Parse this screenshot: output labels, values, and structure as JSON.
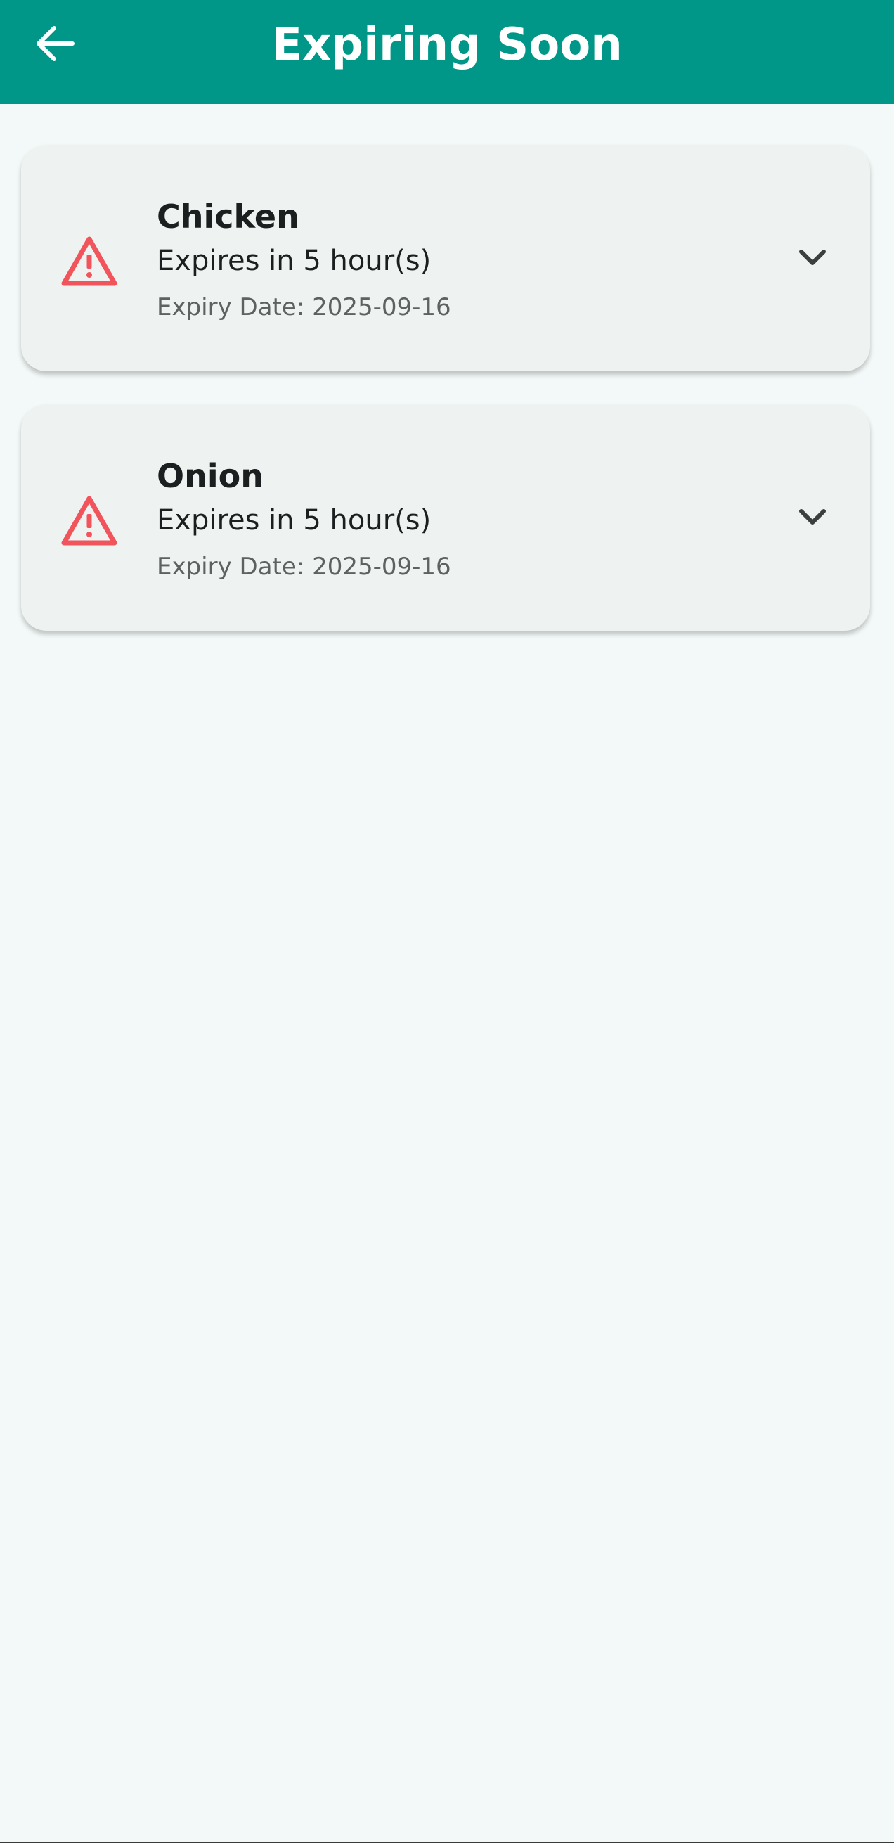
{
  "appbar": {
    "title": "Expiring Soon",
    "back_icon": "arrow-left-icon",
    "color": "#009688"
  },
  "items": [
    {
      "name": "Chicken",
      "expires": "Expires in 5 hour(s)",
      "expiry_date": "Expiry Date: 2025-09-16",
      "icon": "warning-triangle-icon",
      "expand_icon": "chevron-down-icon"
    },
    {
      "name": "Onion",
      "expires": "Expires in 5 hour(s)",
      "expiry_date": "Expiry Date: 2025-09-16",
      "icon": "warning-triangle-icon",
      "expand_icon": "chevron-down-icon"
    }
  ],
  "colors": {
    "warning": "#f2545b",
    "background": "#f3f9f8",
    "card": "#eef3f2"
  }
}
